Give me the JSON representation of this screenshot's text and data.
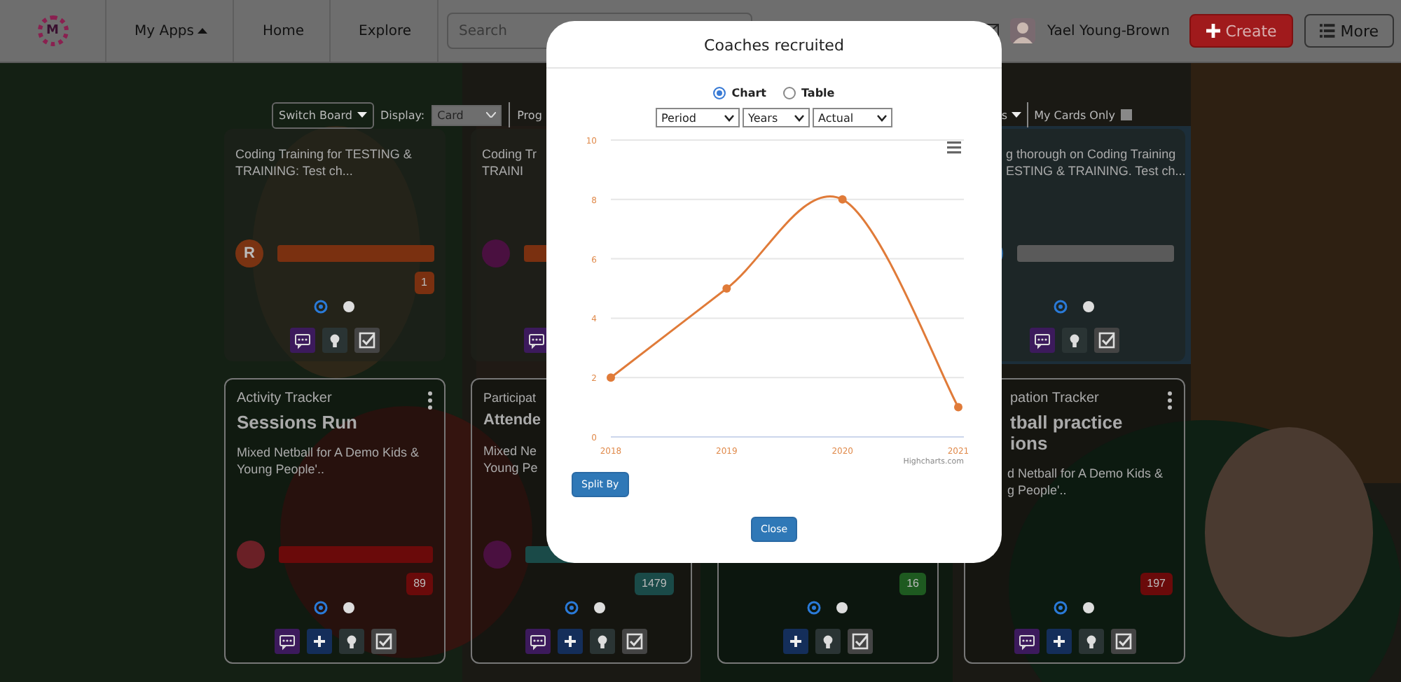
{
  "header": {
    "logo": "M",
    "nav": [
      {
        "label": "My Apps",
        "kind": "menu"
      },
      {
        "label": "Home",
        "kind": "link"
      },
      {
        "label": "Explore",
        "kind": "link"
      }
    ],
    "search": {
      "placeholder": "Search"
    },
    "user": {
      "name": "Yael Young-Brown"
    },
    "buttons": [
      {
        "label": "Create",
        "kind": "create"
      },
      {
        "label": "More",
        "kind": "more"
      }
    ]
  },
  "toolbar": {
    "switch_board": "Switch Board",
    "display_label": "Display:",
    "display_value": "Card",
    "column_5": "Prog",
    "column_6": "s",
    "my_cards_only": {
      "label": "My Cards Only",
      "checked": false
    }
  },
  "cards_row_1": [
    {
      "description_lines": [
        "Coding Training for TESTING &",
        "TRAINING: Test ch..."
      ],
      "avatar": {
        "color": "#7a3312",
        "letter": "R"
      },
      "color": "#7a3010",
      "badge": "1",
      "actions": [
        {
          "kind": "comment"
        },
        {
          "kind": "idea"
        },
        {
          "kind": "complete"
        }
      ]
    },
    {
      "description_lines": [
        "Coding Tr",
        "TRAINI"
      ],
      "avatar": {
        "color": "#4a1040"
      },
      "color": "#7a3010",
      "actions": [
        {
          "kind": "comment"
        }
      ]
    },
    {
      "description_lines": [
        "g thorough on Coding Training",
        "ESTING & TRAINING. Test ch..."
      ],
      "color": "#5a5a5a",
      "actions": [
        {
          "kind": "comment"
        },
        {
          "kind": "idea"
        },
        {
          "kind": "complete"
        }
      ]
    }
  ],
  "cards_row_2": [
    {
      "tracker": "Activity Tracker",
      "title_lines": [
        "Sessions Run"
      ],
      "description_lines": [
        "Mixed Netball for A Demo Kids &",
        "Young People'.."
      ],
      "avatar": {
        "color": "#6a2026"
      },
      "color": "#6a0a0a",
      "badge": "89",
      "actions": [
        {
          "kind": "comment"
        },
        {
          "kind": "add"
        },
        {
          "kind": "idea"
        },
        {
          "kind": "complete"
        }
      ]
    },
    {
      "tracker": "Participat",
      "title_lines": [
        "Attende"
      ],
      "description_lines": [
        "Mixed Ne",
        "Young Pe"
      ],
      "avatar": {
        "color": "#4a1040"
      },
      "color": "#1a4a48",
      "badge": "1479",
      "actions": [
        {
          "kind": "comment"
        },
        {
          "kind": "add"
        },
        {
          "kind": "idea"
        },
        {
          "kind": "complete"
        }
      ]
    },
    {
      "color": "#1e5a20",
      "badge": "16",
      "actions": [
        {
          "kind": "add"
        },
        {
          "kind": "idea"
        },
        {
          "kind": "complete"
        }
      ]
    },
    {
      "tracker": "pation Tracker",
      "title_lines": [
        "tball practice",
        "ions"
      ],
      "description_lines": [
        "d Netball for A Demo Kids &",
        "g People'.."
      ],
      "color": "#6a0a0a",
      "badge": "197",
      "actions": [
        {
          "kind": "comment"
        },
        {
          "kind": "add"
        },
        {
          "kind": "idea"
        },
        {
          "kind": "complete"
        }
      ]
    }
  ],
  "modal": {
    "title": "Coaches recruited",
    "views": [
      {
        "label": "Chart",
        "selected": true
      },
      {
        "label": "Table",
        "selected": false
      }
    ],
    "selects": [
      "Period",
      "Years",
      "Actual"
    ],
    "chart_data": {
      "type": "line",
      "categories": [
        "2018",
        "2019",
        "2020",
        "2021"
      ],
      "series": [
        {
          "color": "#e07b39",
          "marker": true,
          "values": [
            2,
            5,
            8,
            1
          ]
        }
      ],
      "ylim": [
        0,
        10
      ],
      "yticks": [
        0,
        2,
        4,
        6,
        8,
        10
      ],
      "grid": true
    },
    "credit": "Highcharts.com",
    "split_button": "Split By",
    "close_button": "Close"
  }
}
